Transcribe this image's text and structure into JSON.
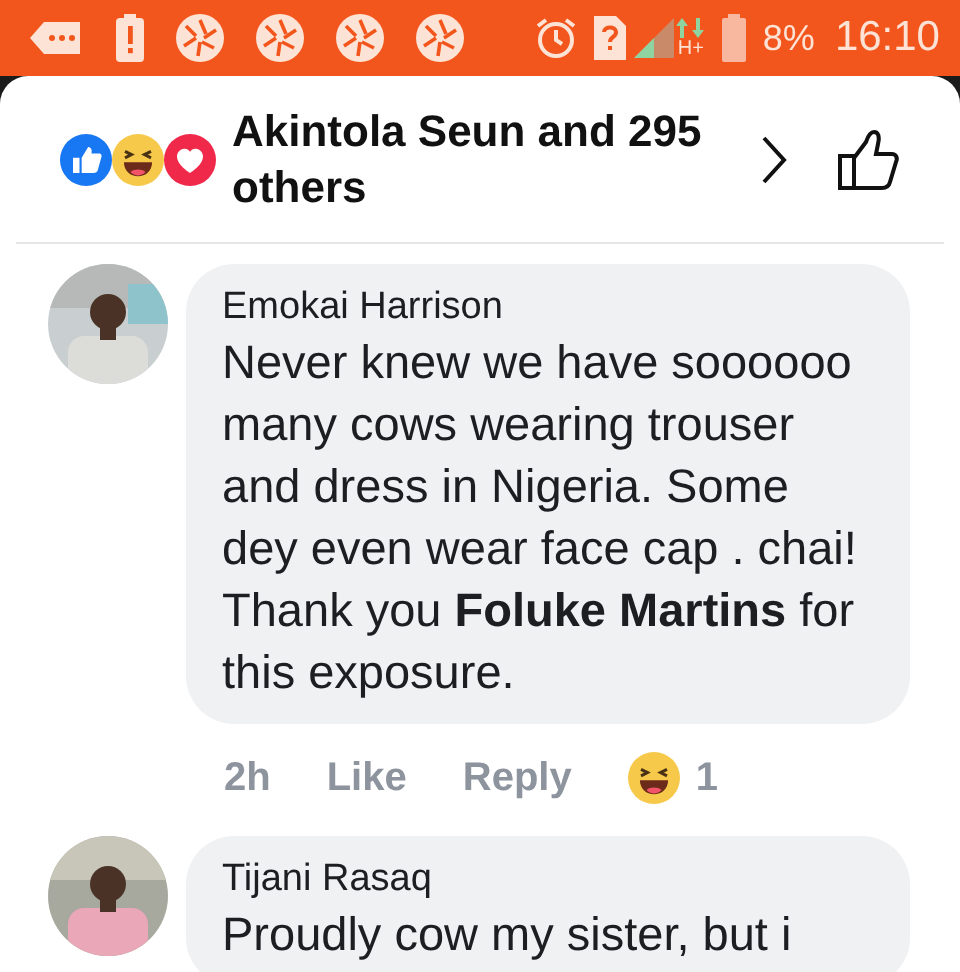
{
  "status_bar": {
    "network_type": "H+",
    "battery": "8%",
    "time": "16:10"
  },
  "reactions_header": {
    "reactions": [
      {
        "kind": "like"
      },
      {
        "kind": "haha"
      },
      {
        "kind": "love"
      }
    ],
    "summary": "Akintola Seun and 295 others"
  },
  "comments": [
    {
      "author": "Emokai Harrison",
      "avatar": {
        "kind": "picture"
      },
      "lines": [
        "Never knew we have soooooo many cows wearing trouser and dress in Nigeria. Some dey even wear face cap . chai! Thank you **Foluke Martins** for this exposure."
      ],
      "time": "2h",
      "like": "Like",
      "reply": "Reply",
      "reaction": {
        "kind": "haha",
        "count": "1"
      }
    },
    {
      "author": "Tijani Rasaq",
      "avatar": {
        "kind": "picture"
      },
      "lines": [
        "Proudly cow my sister, but i"
      ]
    }
  ]
}
